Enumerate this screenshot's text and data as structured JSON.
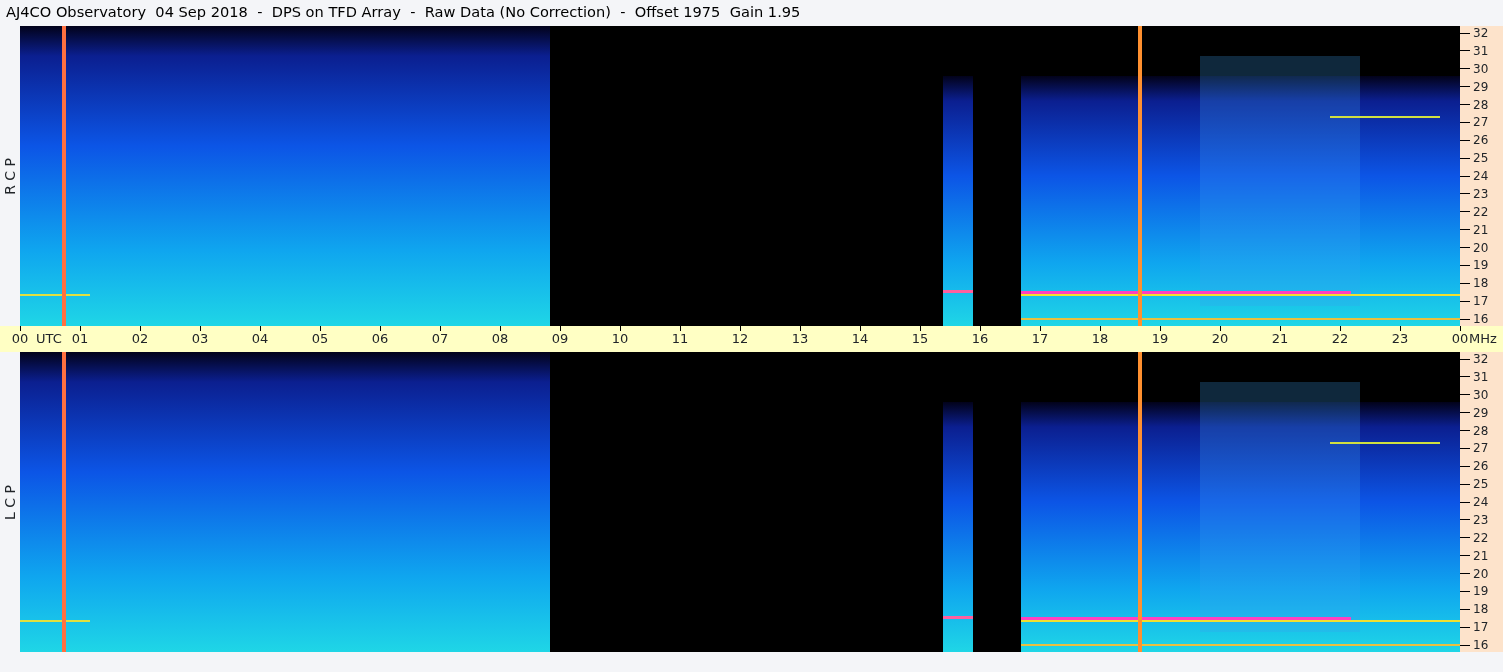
{
  "title": "AJ4CO Observatory  04 Sep 2018  -  DPS on TFD Array  -  Raw Data (No Correction)  -  Offset 1975  Gain 1.95",
  "channels": [
    {
      "label": "R C P",
      "freq_ticks": [
        "32",
        "31",
        "30",
        "29",
        "28",
        "27",
        "26",
        "25",
        "24",
        "23",
        "22",
        "21",
        "20",
        "19",
        "18",
        "17",
        "16"
      ]
    },
    {
      "label": "L C P",
      "freq_ticks": [
        "32",
        "31",
        "30",
        "29",
        "28",
        "27",
        "26",
        "25",
        "24",
        "23",
        "22",
        "21",
        "20",
        "19",
        "18",
        "17",
        "16"
      ]
    }
  ],
  "time_axis": {
    "hours": [
      "00",
      "01",
      "02",
      "03",
      "04",
      "05",
      "06",
      "07",
      "08",
      "09",
      "10",
      "11",
      "12",
      "13",
      "14",
      "15",
      "16",
      "17",
      "18",
      "19",
      "20",
      "21",
      "22",
      "23",
      "00"
    ],
    "zone_label": "UTC",
    "freq_unit": "MHz"
  }
}
